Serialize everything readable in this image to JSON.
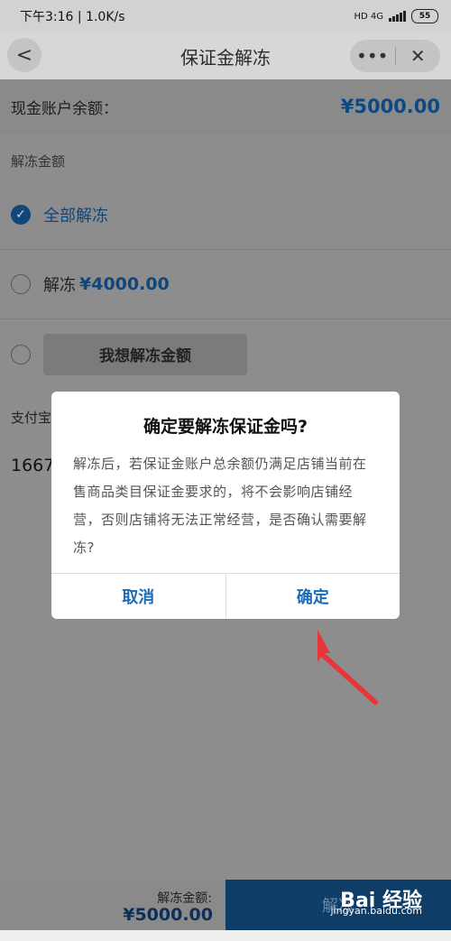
{
  "status_bar": {
    "time": "下午3:16 | 1.0K/s",
    "network": "HD 4G",
    "battery": "55"
  },
  "nav": {
    "title": "保证金解冻",
    "more": "•••",
    "close": "✕",
    "back": "<"
  },
  "balance": {
    "label": "现金账户余额：",
    "value": "¥5000.00"
  },
  "section_label": "解冻金额",
  "options": [
    {
      "label": "全部解冻"
    },
    {
      "label": "解冻",
      "amount": "¥4000.00"
    },
    {
      "button_label": "我想解冻金额"
    }
  ],
  "pay": {
    "label": "支付宝",
    "value": "1667"
  },
  "dialog": {
    "title": "确定要解冻保证金吗?",
    "body": "解冻后，若保证金账户总余额仍满足店铺当前在售商品类目保证金要求的，将不会影响店铺经营，否则店铺将无法正常经营，是否确认需要解冻?",
    "cancel": "取消",
    "confirm": "确定"
  },
  "bottom": {
    "label": "解冻金额:",
    "amount": "¥5000.00",
    "button": "解冻"
  },
  "watermark": {
    "logo": "Bai 经验",
    "url": "jingyan.baidu.com"
  },
  "colors": {
    "accent": "#10467a",
    "dialog_button": "#1b6cb5",
    "arrow": "#e8353a"
  }
}
